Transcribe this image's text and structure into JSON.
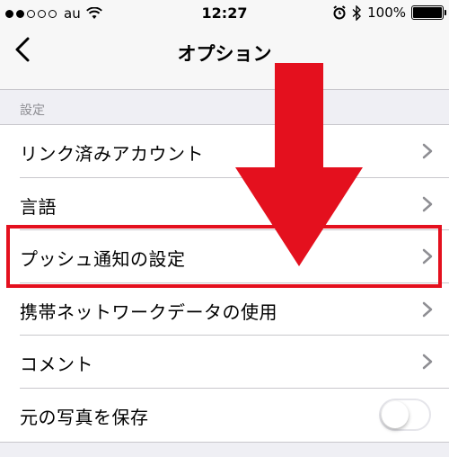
{
  "status_bar": {
    "carrier": "au",
    "time": "12:27",
    "battery": "100%",
    "signal_bars_filled": 2,
    "signal_bars_total": 5
  },
  "nav": {
    "title": "オプション",
    "back_icon": "chevron-left-icon"
  },
  "section": {
    "header": "設定"
  },
  "rows": [
    {
      "label": "リンク済みアカウント",
      "accessory": "chevron-right-icon"
    },
    {
      "label": "言語",
      "accessory": "chevron-right-icon"
    },
    {
      "label": "プッシュ通知の設定",
      "accessory": "chevron-right-icon",
      "highlighted": true
    },
    {
      "label": "携帯ネットワークデータの使用",
      "accessory": "chevron-right-icon"
    },
    {
      "label": "コメント",
      "accessory": "chevron-right-icon"
    },
    {
      "label": "元の写真を保存",
      "accessory": "toggle",
      "toggle_on": false
    }
  ],
  "colors": {
    "annotation_red": "#e4101e",
    "chevron_gray": "#8e8e93",
    "separator": "#c8c7cc"
  }
}
